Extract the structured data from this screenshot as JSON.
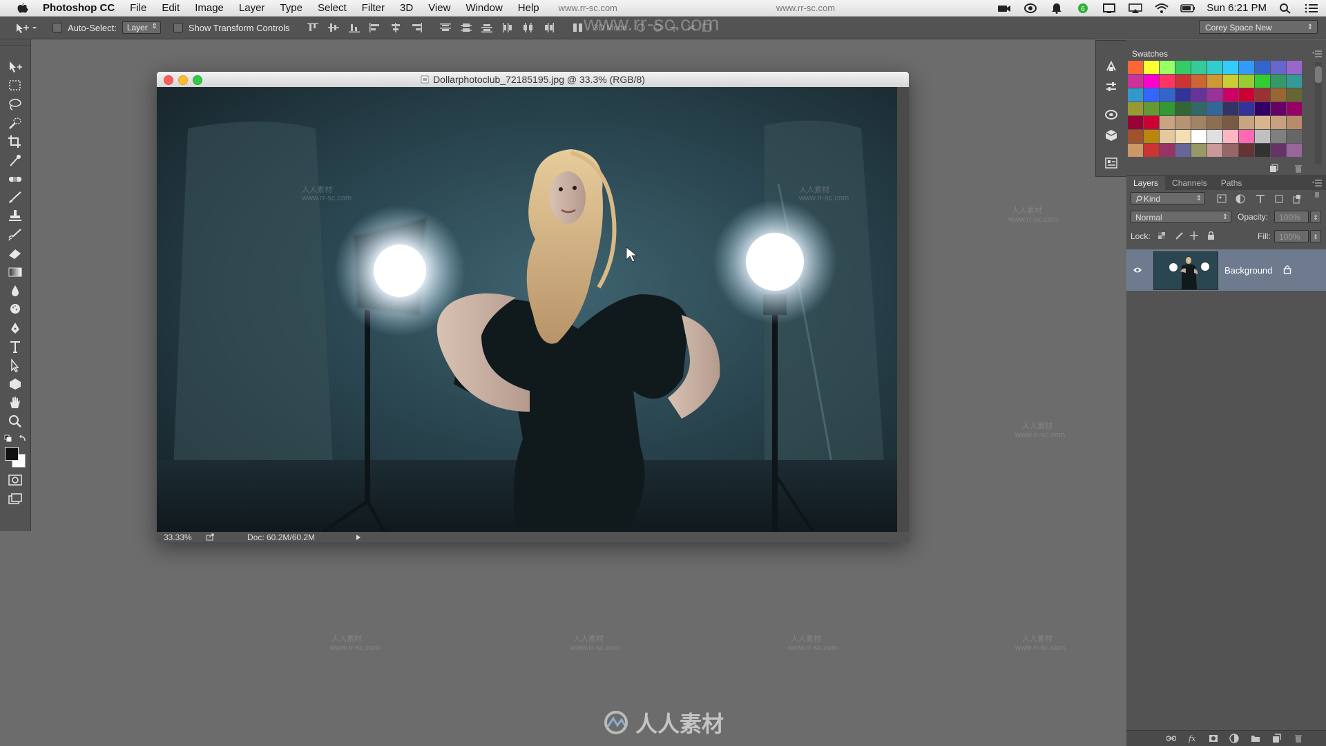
{
  "menubar": {
    "app_name": "Photoshop CC",
    "items": [
      "File",
      "Edit",
      "Image",
      "Layer",
      "Type",
      "Select",
      "Filter",
      "3D",
      "View",
      "Window",
      "Help"
    ],
    "clock": "Sun 6:21 PM",
    "watermark_url": "www.rr-sc.com"
  },
  "options_bar": {
    "auto_select_label": "Auto-Select:",
    "auto_select_value": "Layer",
    "transform_label": "Show Transform Controls",
    "mode_label": "3D Mode:",
    "workspace": "Corey Space New"
  },
  "document": {
    "title": "Dollarphotoclub_72185195.jpg @ 33.3% (RGB/8)",
    "zoom": "33.33%",
    "doc_size": "Doc: 60.2M/60.2M"
  },
  "swatches": {
    "tab_label": "Swatches",
    "colors": [
      "#ff6633",
      "#ffff33",
      "#99ff66",
      "#33cc66",
      "#33cc99",
      "#33cccc",
      "#33ccff",
      "#3399ff",
      "#3366cc",
      "#6666cc",
      "#9966cc",
      "#cc3399",
      "#ff00cc",
      "#ff3366",
      "#cc3333",
      "#cc6633",
      "#cc9933",
      "#cccc33",
      "#99cc33",
      "#33cc33",
      "#339966",
      "#339999",
      "#3399cc",
      "#3366ff",
      "#3366cc",
      "#333399",
      "#663399",
      "#993399",
      "#cc0066",
      "#cc0033",
      "#993333",
      "#996633",
      "#666633",
      "#999933",
      "#669933",
      "#339933",
      "#336633",
      "#336666",
      "#336699",
      "#333366",
      "#333399",
      "#330066",
      "#660066",
      "#990066",
      "#990033",
      "#cc0033",
      "#c8a482",
      "#b59474",
      "#a38366",
      "#8e6e52",
      "#7a5b42",
      "#c8a482",
      "#d9b48f",
      "#c89f7f",
      "#b88c6a",
      "#a0522d",
      "#b8860b",
      "#e6c8a0",
      "#f5deb3",
      "#ffffff",
      "#e0e0e0",
      "#ffb6c1",
      "#ff69b4",
      "#c0c0c0",
      "#808080",
      "#666666",
      "#cc9966",
      "#cc3333",
      "#993366",
      "#666699",
      "#999966",
      "#cc9999",
      "#996666",
      "#663333",
      "#333333",
      "#663366",
      "#996699"
    ]
  },
  "layers_panel": {
    "tabs": [
      "Layers",
      "Channels",
      "Paths"
    ],
    "kind_label": "Kind",
    "blend_mode": "Normal",
    "opacity_label": "Opacity:",
    "opacity_value": "100%",
    "lock_label": "Lock:",
    "fill_label": "Fill:",
    "fill_value": "100%",
    "layer_name": "Background"
  },
  "watermarks": {
    "site": "人人素材",
    "url": "www.rr-sc.com"
  }
}
